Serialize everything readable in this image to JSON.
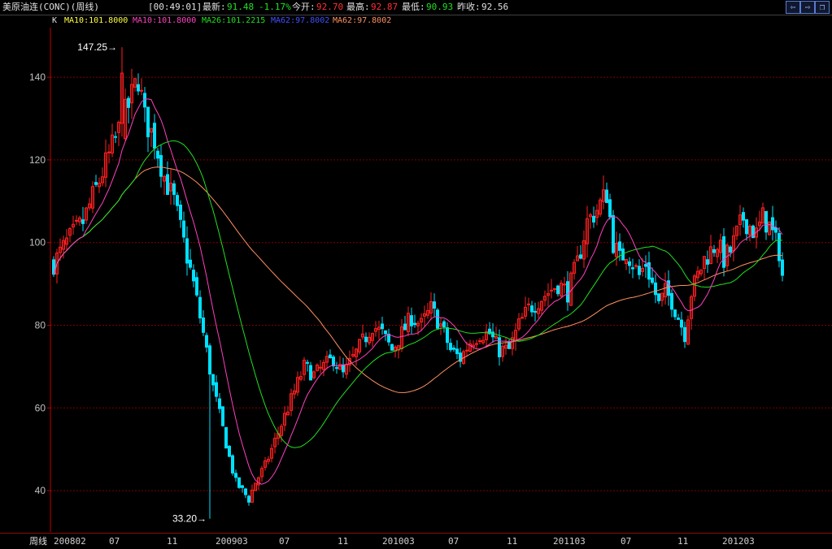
{
  "header": {
    "title": "美原油连(CONC)(周线)",
    "time": "[00:49:01]",
    "latest_label": "最新:",
    "latest_value": "91.48",
    "change": "-1.17%",
    "open_label": "今开:",
    "open_value": "92.70",
    "high_label": "最高:",
    "high_value": "92.87",
    "low_label": "最低:",
    "low_value": "90.93",
    "prev_close_label": "昨收:",
    "prev_close_value": "92.56",
    "btn_left": "⇦",
    "btn_right": "⇨",
    "btn_restore": "❐"
  },
  "legend": {
    "k": "K",
    "ma10a": "MA10:101.8000",
    "ma10b": "MA10:101.8000",
    "ma26": "MA26:101.2215",
    "ma62a": "MA62:97.8002",
    "ma62b": "MA62:97.8002"
  },
  "colors": {
    "up": "#ff2020",
    "down": "#00e0ff",
    "ma10": "#ff40c0",
    "ma26": "#20e020",
    "ma62": "#ff9060",
    "grid": "#800000",
    "axis": "#c00000",
    "text": "#c0c0c0"
  },
  "bottom": {
    "period_label": "周线"
  },
  "chart_data": {
    "type": "candlestick",
    "title": "美原油连(CONC)(周线)",
    "ylim": [
      30,
      152
    ],
    "yticks": [
      40,
      60,
      80,
      100,
      120,
      140
    ],
    "xticks": [
      "200802",
      "07",
      "11",
      "200903",
      "07",
      "11",
      "201003",
      "07",
      "11",
      "201103",
      "07",
      "11",
      "201203"
    ],
    "annotations": {
      "high": "147.25",
      "low": "33.20"
    },
    "close_points": [
      [
        0,
        95
      ],
      [
        4,
        100
      ],
      [
        9,
        105
      ],
      [
        14,
        115
      ],
      [
        19,
        125
      ],
      [
        23,
        133
      ],
      [
        26,
        140
      ],
      [
        28,
        130
      ],
      [
        31,
        125
      ],
      [
        34,
        116
      ],
      [
        37,
        110
      ],
      [
        40,
        100
      ],
      [
        43,
        90
      ],
      [
        46,
        78
      ],
      [
        49,
        65
      ],
      [
        52,
        55
      ],
      [
        54,
        48
      ],
      [
        56,
        42
      ],
      [
        58,
        40
      ],
      [
        60,
        38
      ],
      [
        62,
        42
      ],
      [
        65,
        46
      ],
      [
        68,
        52
      ],
      [
        71,
        58
      ],
      [
        74,
        64
      ],
      [
        77,
        70
      ],
      [
        80,
        68
      ],
      [
        83,
        70
      ],
      [
        86,
        72
      ],
      [
        89,
        68
      ],
      [
        92,
        72
      ],
      [
        95,
        76
      ],
      [
        98,
        80
      ],
      [
        101,
        78
      ],
      [
        104,
        74
      ],
      [
        107,
        78
      ],
      [
        110,
        82
      ],
      [
        113,
        80
      ],
      [
        116,
        84
      ],
      [
        119,
        80
      ],
      [
        122,
        74
      ],
      [
        125,
        72
      ],
      [
        128,
        76
      ],
      [
        131,
        78
      ],
      [
        134,
        78
      ],
      [
        137,
        74
      ],
      [
        140,
        74
      ],
      [
        143,
        80
      ],
      [
        146,
        84
      ],
      [
        149,
        86
      ],
      [
        152,
        88
      ],
      [
        155,
        90
      ],
      [
        158,
        88
      ],
      [
        161,
        95
      ],
      [
        164,
        105
      ],
      [
        167,
        108
      ],
      [
        170,
        112
      ],
      [
        172,
        100
      ],
      [
        174,
        96
      ],
      [
        176,
        98
      ],
      [
        178,
        95
      ],
      [
        180,
        92
      ],
      [
        182,
        95
      ],
      [
        184,
        90
      ],
      [
        186,
        85
      ],
      [
        188,
        88
      ],
      [
        190,
        86
      ],
      [
        192,
        82
      ],
      [
        194,
        78
      ],
      [
        196,
        88
      ],
      [
        198,
        92
      ],
      [
        200,
        96
      ],
      [
        202,
        98
      ],
      [
        204,
        100
      ],
      [
        206,
        96
      ],
      [
        208,
        98
      ],
      [
        210,
        102
      ],
      [
        212,
        106
      ],
      [
        214,
        104
      ],
      [
        216,
        102
      ],
      [
        218,
        106
      ],
      [
        220,
        104
      ],
      [
        222,
        100
      ],
      [
        223,
        98
      ],
      [
        224,
        92
      ]
    ]
  }
}
